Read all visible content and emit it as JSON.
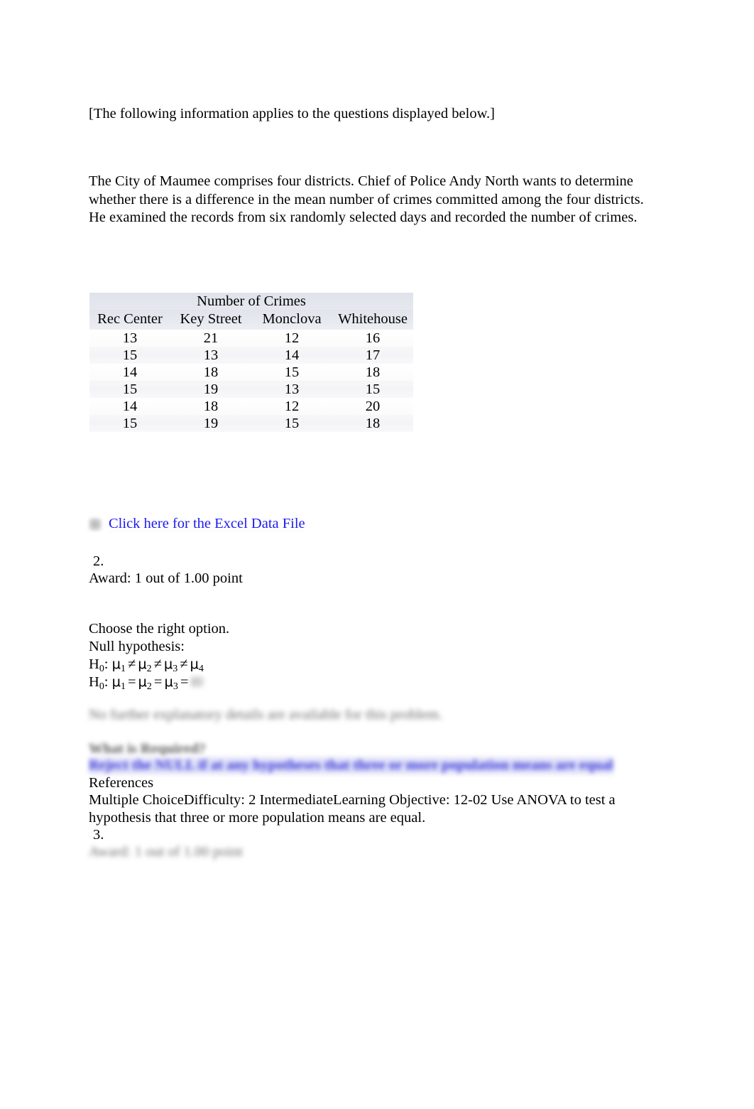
{
  "document": {
    "intro_note": "[The following information applies to the questions displayed below.]",
    "scenario_lines": [
      "The City of Maumee comprises four districts. Chief of Police Andy North wants to determine",
      "whether there is a difference in the mean number of crimes committed among the four districts.",
      "He examined the records from six randomly selected days and recorded the number of crimes."
    ]
  },
  "table": {
    "super_header": "Number of Crimes",
    "columns": [
      "Rec Center",
      "Key Street",
      "Monclova",
      "Whitehouse"
    ],
    "rows": [
      [
        "13",
        "21",
        "12",
        "16"
      ],
      [
        "15",
        "13",
        "14",
        "17"
      ],
      [
        "14",
        "18",
        "15",
        "18"
      ],
      [
        "15",
        "19",
        "13",
        "15"
      ],
      [
        "14",
        "18",
        "12",
        "20"
      ],
      [
        "15",
        "19",
        "15",
        "18"
      ]
    ]
  },
  "excel": {
    "icon": "spreadsheet-icon",
    "link_label": "Click here for the Excel Data File",
    "link_color": "#1a1aee"
  },
  "question2": {
    "number": "2.",
    "award": "Award: 1 out of 1.00 point",
    "prompt": "Choose the right option.",
    "null_label": "Null hypothesis:",
    "hypothesis_1": {
      "prefix": "H",
      "sub": "0",
      "colon": ":",
      "terms": [
        "μ",
        "μ",
        "μ",
        "μ"
      ],
      "subs": [
        "1",
        "2",
        "3",
        "4"
      ],
      "operator": "≠"
    },
    "hypothesis_2": {
      "prefix": "H",
      "sub": "0",
      "colon": ":",
      "terms": [
        "μ",
        "μ",
        "μ"
      ],
      "subs": [
        "1",
        "2",
        "3"
      ],
      "operator": "="
    },
    "explanation_blurred": "No further explanatory details are available for this problem.",
    "requirement_heading_blurred": "What is Required?",
    "selected_answer_blurred": "Reject the NULL if at any hypotheses that three or more population means are equal",
    "references_label": "References",
    "reference_meta": "Multiple ChoiceDifficulty: 2 IntermediateLearning Objective: 12-02 Use ANOVA to test a hypothesis that three or more population means are equal."
  },
  "question3": {
    "number": "3.",
    "award_blurred": "Award: 1 out of 1.00 point"
  }
}
